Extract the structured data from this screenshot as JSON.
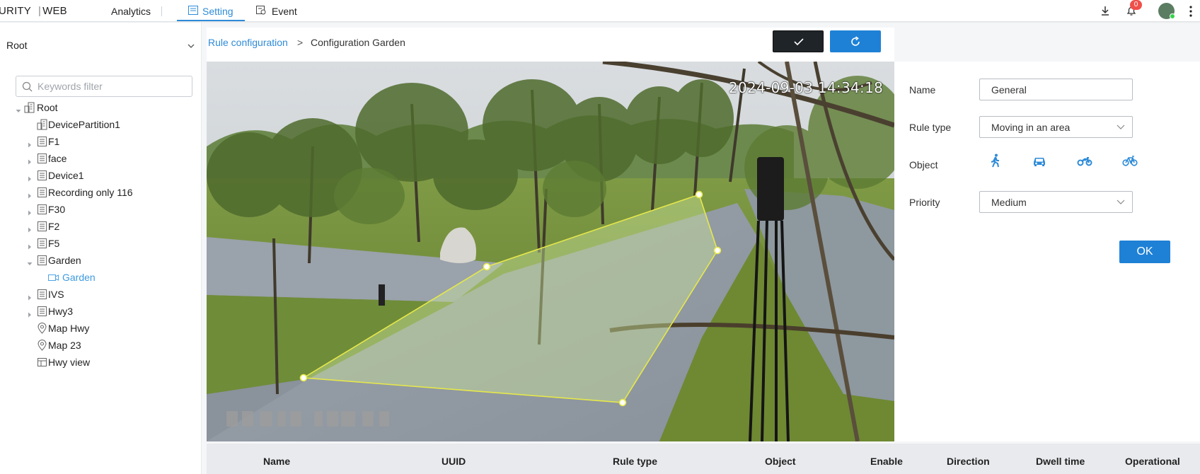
{
  "topbar": {
    "brand_left": "URITY",
    "brand_right": "WEB",
    "nav": {
      "analytics": "Analytics",
      "setting": "Setting",
      "event": "Event"
    },
    "notification_count": "0"
  },
  "sidebar": {
    "title": "Root",
    "search_placeholder": "Keywords filter",
    "tree": [
      {
        "label": "Root",
        "icon": "building-icon",
        "level": 0,
        "expanded": true
      },
      {
        "label": "DevicePartition1",
        "icon": "building-icon",
        "level": 1
      },
      {
        "label": "F1",
        "icon": "folder-list-icon",
        "level": 1,
        "expandable": true
      },
      {
        "label": "face",
        "icon": "folder-list-icon",
        "level": 1,
        "expandable": true
      },
      {
        "label": "Device1",
        "icon": "folder-list-icon",
        "level": 1,
        "expandable": true
      },
      {
        "label": "Recording only 116",
        "icon": "folder-list-icon",
        "level": 1,
        "expandable": true
      },
      {
        "label": "F30",
        "icon": "folder-list-icon",
        "level": 1,
        "expandable": true
      },
      {
        "label": "F2",
        "icon": "folder-list-icon",
        "level": 1,
        "expandable": true
      },
      {
        "label": "F5",
        "icon": "folder-list-icon",
        "level": 1,
        "expandable": true
      },
      {
        "label": "Garden",
        "icon": "folder-list-icon",
        "level": 1,
        "expanded": true
      },
      {
        "label": "Garden",
        "icon": "camera-icon",
        "level": 2,
        "active": true
      },
      {
        "label": "IVS",
        "icon": "folder-list-icon",
        "level": 1,
        "expandable": true
      },
      {
        "label": "Hwy3",
        "icon": "folder-list-icon",
        "level": 1,
        "expandable": true
      },
      {
        "label": "Map Hwy",
        "icon": "map-pin-icon",
        "level": 1
      },
      {
        "label": "Map 23",
        "icon": "map-pin-icon",
        "level": 1
      },
      {
        "label": "Hwy view",
        "icon": "grid-view-icon",
        "level": 1
      }
    ]
  },
  "breadcrumb": {
    "link": "Rule configuration",
    "separator": ">",
    "current": "Configuration Garden"
  },
  "video": {
    "timestamp": "2024-09-03 14:34:18"
  },
  "rule_form": {
    "name_label": "Name",
    "name_value": "General",
    "rule_type_label": "Rule type",
    "rule_type_value": "Moving in an area",
    "object_label": "Object",
    "objects": [
      "person-icon",
      "car-icon",
      "motorcycle-icon",
      "bicycle-icon"
    ],
    "priority_label": "Priority",
    "priority_value": "Medium",
    "ok_label": "OK"
  },
  "table": {
    "columns": [
      "Name",
      "UUID",
      "Rule type",
      "Object",
      "Enable",
      "Direction",
      "Dwell time",
      "Operational"
    ]
  },
  "colors": {
    "accent": "#1e81d6",
    "link": "#2e8bd8",
    "zone": "#e6e84a"
  }
}
